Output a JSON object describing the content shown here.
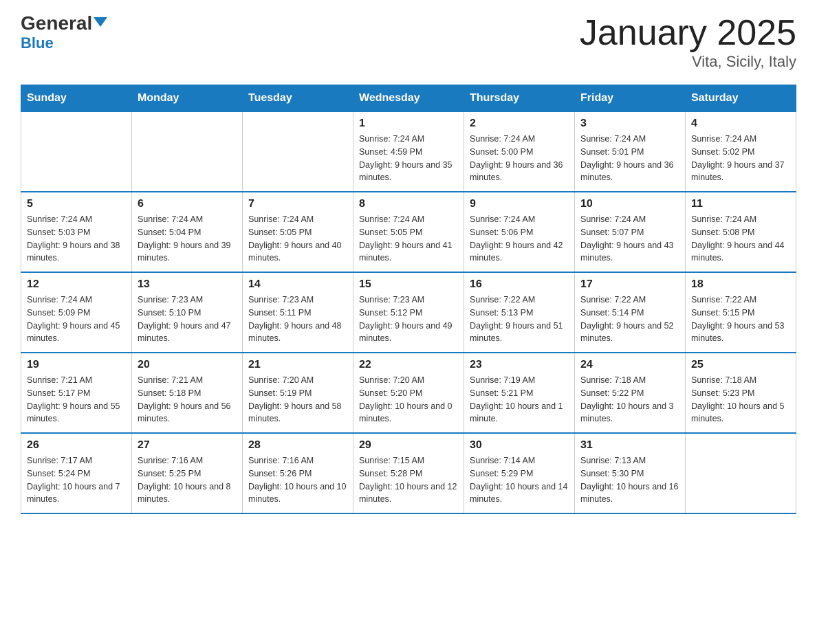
{
  "header": {
    "logo": {
      "part1": "General",
      "arrow": "▼",
      "part2": "Blue"
    },
    "title": "January 2025",
    "subtitle": "Vita, Sicily, Italy"
  },
  "days_of_week": [
    "Sunday",
    "Monday",
    "Tuesday",
    "Wednesday",
    "Thursday",
    "Friday",
    "Saturday"
  ],
  "weeks": [
    [
      {
        "day": "",
        "info": ""
      },
      {
        "day": "",
        "info": ""
      },
      {
        "day": "",
        "info": ""
      },
      {
        "day": "1",
        "info": "Sunrise: 7:24 AM\nSunset: 4:59 PM\nDaylight: 9 hours and 35 minutes."
      },
      {
        "day": "2",
        "info": "Sunrise: 7:24 AM\nSunset: 5:00 PM\nDaylight: 9 hours and 36 minutes."
      },
      {
        "day": "3",
        "info": "Sunrise: 7:24 AM\nSunset: 5:01 PM\nDaylight: 9 hours and 36 minutes."
      },
      {
        "day": "4",
        "info": "Sunrise: 7:24 AM\nSunset: 5:02 PM\nDaylight: 9 hours and 37 minutes."
      }
    ],
    [
      {
        "day": "5",
        "info": "Sunrise: 7:24 AM\nSunset: 5:03 PM\nDaylight: 9 hours and 38 minutes."
      },
      {
        "day": "6",
        "info": "Sunrise: 7:24 AM\nSunset: 5:04 PM\nDaylight: 9 hours and 39 minutes."
      },
      {
        "day": "7",
        "info": "Sunrise: 7:24 AM\nSunset: 5:05 PM\nDaylight: 9 hours and 40 minutes."
      },
      {
        "day": "8",
        "info": "Sunrise: 7:24 AM\nSunset: 5:05 PM\nDaylight: 9 hours and 41 minutes."
      },
      {
        "day": "9",
        "info": "Sunrise: 7:24 AM\nSunset: 5:06 PM\nDaylight: 9 hours and 42 minutes."
      },
      {
        "day": "10",
        "info": "Sunrise: 7:24 AM\nSunset: 5:07 PM\nDaylight: 9 hours and 43 minutes."
      },
      {
        "day": "11",
        "info": "Sunrise: 7:24 AM\nSunset: 5:08 PM\nDaylight: 9 hours and 44 minutes."
      }
    ],
    [
      {
        "day": "12",
        "info": "Sunrise: 7:24 AM\nSunset: 5:09 PM\nDaylight: 9 hours and 45 minutes."
      },
      {
        "day": "13",
        "info": "Sunrise: 7:23 AM\nSunset: 5:10 PM\nDaylight: 9 hours and 47 minutes."
      },
      {
        "day": "14",
        "info": "Sunrise: 7:23 AM\nSunset: 5:11 PM\nDaylight: 9 hours and 48 minutes."
      },
      {
        "day": "15",
        "info": "Sunrise: 7:23 AM\nSunset: 5:12 PM\nDaylight: 9 hours and 49 minutes."
      },
      {
        "day": "16",
        "info": "Sunrise: 7:22 AM\nSunset: 5:13 PM\nDaylight: 9 hours and 51 minutes."
      },
      {
        "day": "17",
        "info": "Sunrise: 7:22 AM\nSunset: 5:14 PM\nDaylight: 9 hours and 52 minutes."
      },
      {
        "day": "18",
        "info": "Sunrise: 7:22 AM\nSunset: 5:15 PM\nDaylight: 9 hours and 53 minutes."
      }
    ],
    [
      {
        "day": "19",
        "info": "Sunrise: 7:21 AM\nSunset: 5:17 PM\nDaylight: 9 hours and 55 minutes."
      },
      {
        "day": "20",
        "info": "Sunrise: 7:21 AM\nSunset: 5:18 PM\nDaylight: 9 hours and 56 minutes."
      },
      {
        "day": "21",
        "info": "Sunrise: 7:20 AM\nSunset: 5:19 PM\nDaylight: 9 hours and 58 minutes."
      },
      {
        "day": "22",
        "info": "Sunrise: 7:20 AM\nSunset: 5:20 PM\nDaylight: 10 hours and 0 minutes."
      },
      {
        "day": "23",
        "info": "Sunrise: 7:19 AM\nSunset: 5:21 PM\nDaylight: 10 hours and 1 minute."
      },
      {
        "day": "24",
        "info": "Sunrise: 7:18 AM\nSunset: 5:22 PM\nDaylight: 10 hours and 3 minutes."
      },
      {
        "day": "25",
        "info": "Sunrise: 7:18 AM\nSunset: 5:23 PM\nDaylight: 10 hours and 5 minutes."
      }
    ],
    [
      {
        "day": "26",
        "info": "Sunrise: 7:17 AM\nSunset: 5:24 PM\nDaylight: 10 hours and 7 minutes."
      },
      {
        "day": "27",
        "info": "Sunrise: 7:16 AM\nSunset: 5:25 PM\nDaylight: 10 hours and 8 minutes."
      },
      {
        "day": "28",
        "info": "Sunrise: 7:16 AM\nSunset: 5:26 PM\nDaylight: 10 hours and 10 minutes."
      },
      {
        "day": "29",
        "info": "Sunrise: 7:15 AM\nSunset: 5:28 PM\nDaylight: 10 hours and 12 minutes."
      },
      {
        "day": "30",
        "info": "Sunrise: 7:14 AM\nSunset: 5:29 PM\nDaylight: 10 hours and 14 minutes."
      },
      {
        "day": "31",
        "info": "Sunrise: 7:13 AM\nSunset: 5:30 PM\nDaylight: 10 hours and 16 minutes."
      },
      {
        "day": "",
        "info": ""
      }
    ]
  ]
}
